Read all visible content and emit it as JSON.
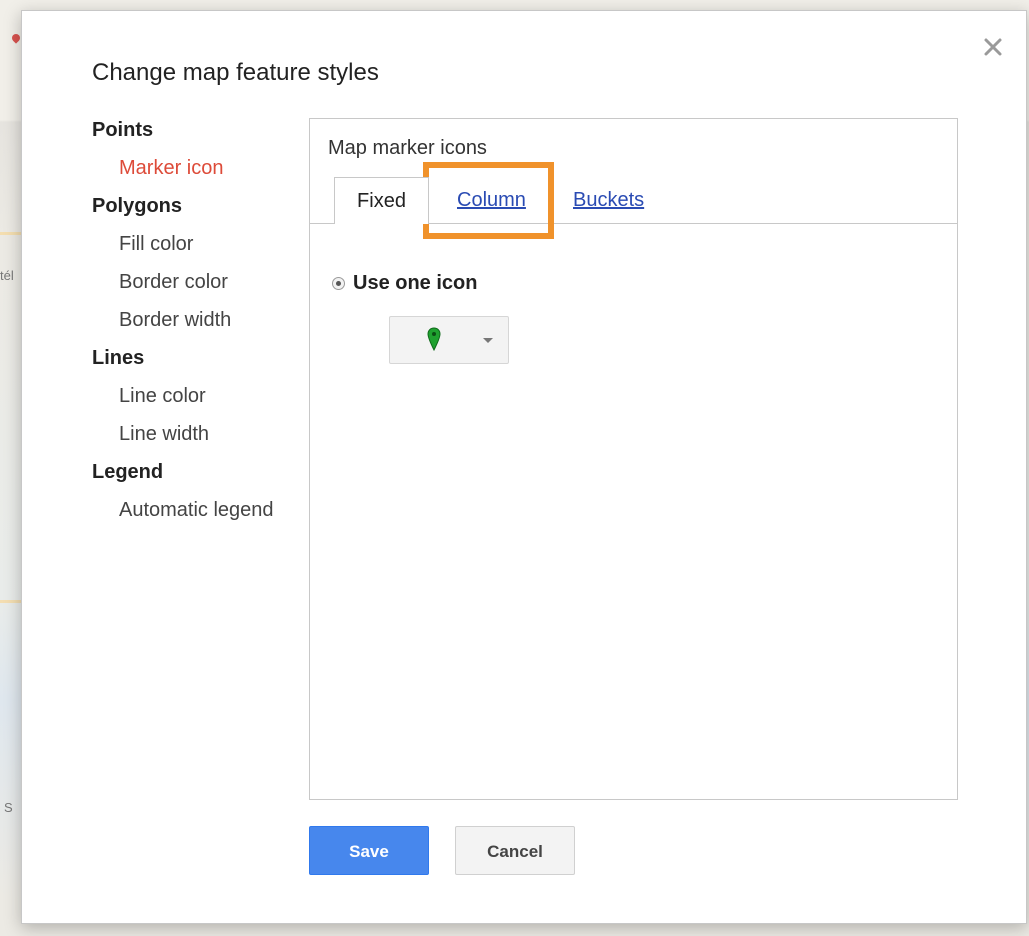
{
  "dialog": {
    "title": "Change map feature styles",
    "close_icon": "close-icon"
  },
  "sidebar": {
    "groups": [
      {
        "label": "Points",
        "items": [
          {
            "label": "Marker icon",
            "active": true
          }
        ]
      },
      {
        "label": "Polygons",
        "items": [
          {
            "label": "Fill color"
          },
          {
            "label": "Border color"
          },
          {
            "label": "Border width"
          }
        ]
      },
      {
        "label": "Lines",
        "items": [
          {
            "label": "Line color"
          },
          {
            "label": "Line width"
          }
        ]
      },
      {
        "label": "Legend",
        "items": [
          {
            "label": "Automatic legend"
          }
        ]
      }
    ]
  },
  "panel": {
    "title": "Map marker icons",
    "tabs": [
      {
        "label": "Fixed",
        "active": true
      },
      {
        "label": "Column",
        "highlighted": true
      },
      {
        "label": "Buckets"
      }
    ],
    "option": {
      "label": "Use one icon",
      "selected": true
    },
    "icon_picker": {
      "icon": "green-map-pin-icon",
      "icon_color": "#1fa12f",
      "dropdown_icon": "caret-down-icon"
    }
  },
  "buttons": {
    "save": "Save",
    "cancel": "Cancel"
  },
  "colors": {
    "active_sidebar_item": "#dd4b39",
    "link": "#2a4bb3",
    "highlight": "#f0922b",
    "save_button": "#4787ed"
  }
}
